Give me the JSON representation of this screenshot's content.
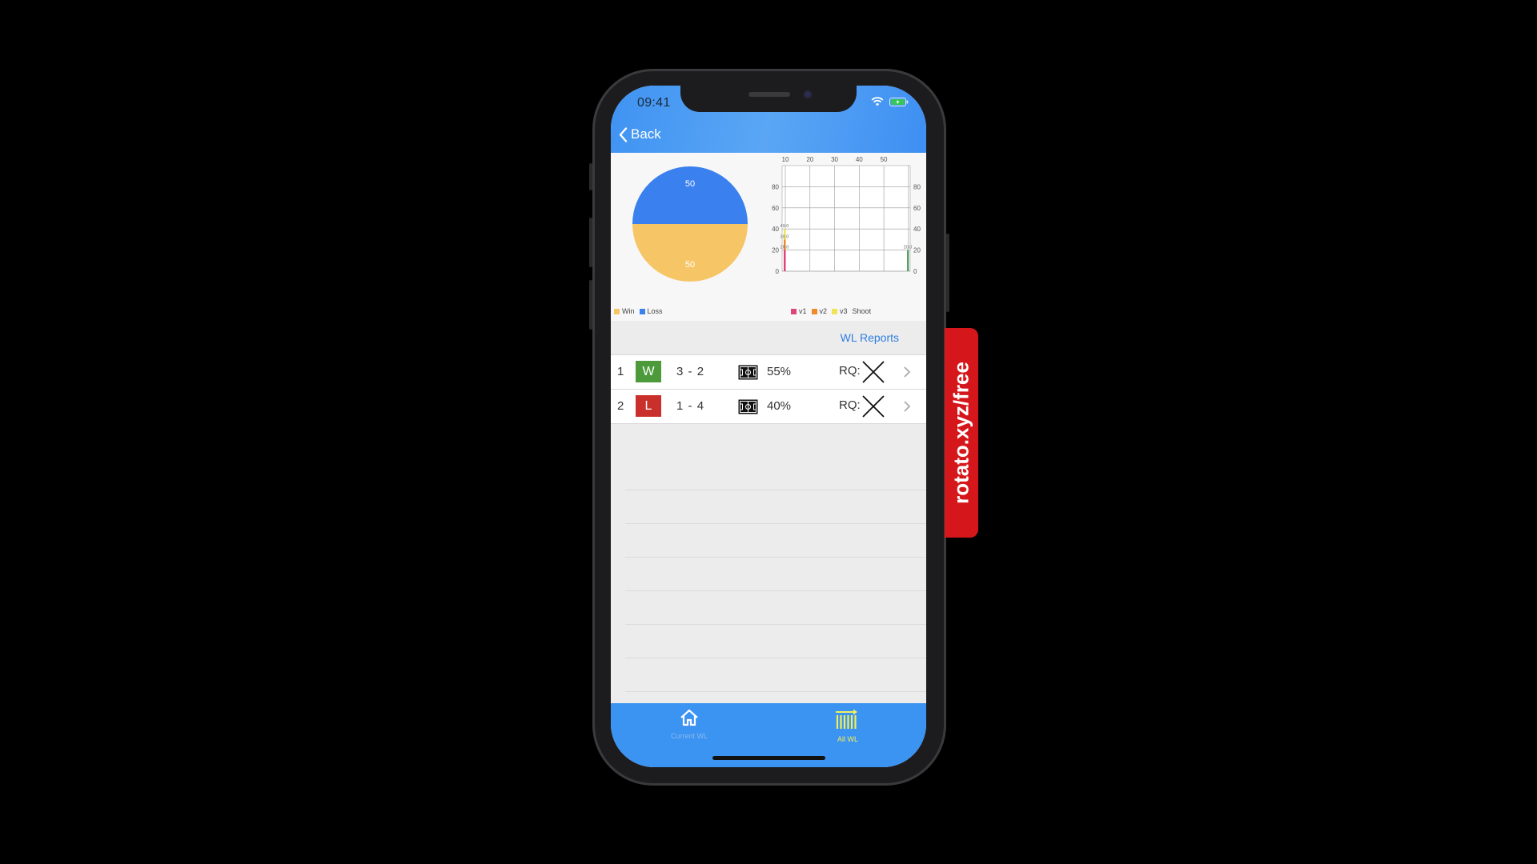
{
  "status_bar": {
    "time": "09:41"
  },
  "nav": {
    "back_label": "Back"
  },
  "colors": {
    "header_blue": "#3f93f2",
    "win_yellow": "#f6c666",
    "loss_blue": "#3a80ee",
    "win_badge": "#4c9a3a",
    "loss_badge": "#c9302c",
    "v1": "#e0447a",
    "v2": "#f08a2a",
    "v3": "#f2e45a",
    "shoot": "#5aa06a"
  },
  "pie_chart": {
    "type": "pie",
    "slices": [
      {
        "label": "Loss",
        "value": 50,
        "display": "50"
      },
      {
        "label": "Win",
        "value": 50,
        "display": "50"
      }
    ],
    "legend": [
      "Win",
      "Loss"
    ]
  },
  "chart_data": {
    "type": "bar",
    "x_ticks_top": [
      "10",
      "20",
      "30",
      "40",
      "50"
    ],
    "y_ticks_left": [
      "0",
      "20",
      "40",
      "60",
      "80"
    ],
    "y_ticks_right": [
      "0",
      "20",
      "40",
      "60",
      "80"
    ],
    "ylim": [
      0,
      100
    ],
    "series": [
      {
        "name": "v1",
        "value": 20.0,
        "label": "20.0"
      },
      {
        "name": "v2",
        "value": 30.0,
        "label": "30.0"
      },
      {
        "name": "v3",
        "value": 40.0,
        "label": "40.0"
      },
      {
        "name": "Shoot",
        "value": 20.0,
        "label": "20.0"
      }
    ],
    "legend": [
      "v1",
      "v2",
      "v3",
      "Shoot"
    ]
  },
  "reports_link": "WL Reports",
  "games": [
    {
      "index": "1",
      "result": "W",
      "score_home": "3",
      "score_away": "2",
      "possession": "55%",
      "rq_label": "RQ:"
    },
    {
      "index": "2",
      "result": "L",
      "score_home": "1",
      "score_away": "4",
      "possession": "40%",
      "rq_label": "RQ:"
    }
  ],
  "tabs": [
    {
      "label": "Current WL",
      "icon": "home-icon"
    },
    {
      "label": "All WL",
      "icon": "all-wl-icon"
    }
  ],
  "watermark": "rotato.xyz/free"
}
